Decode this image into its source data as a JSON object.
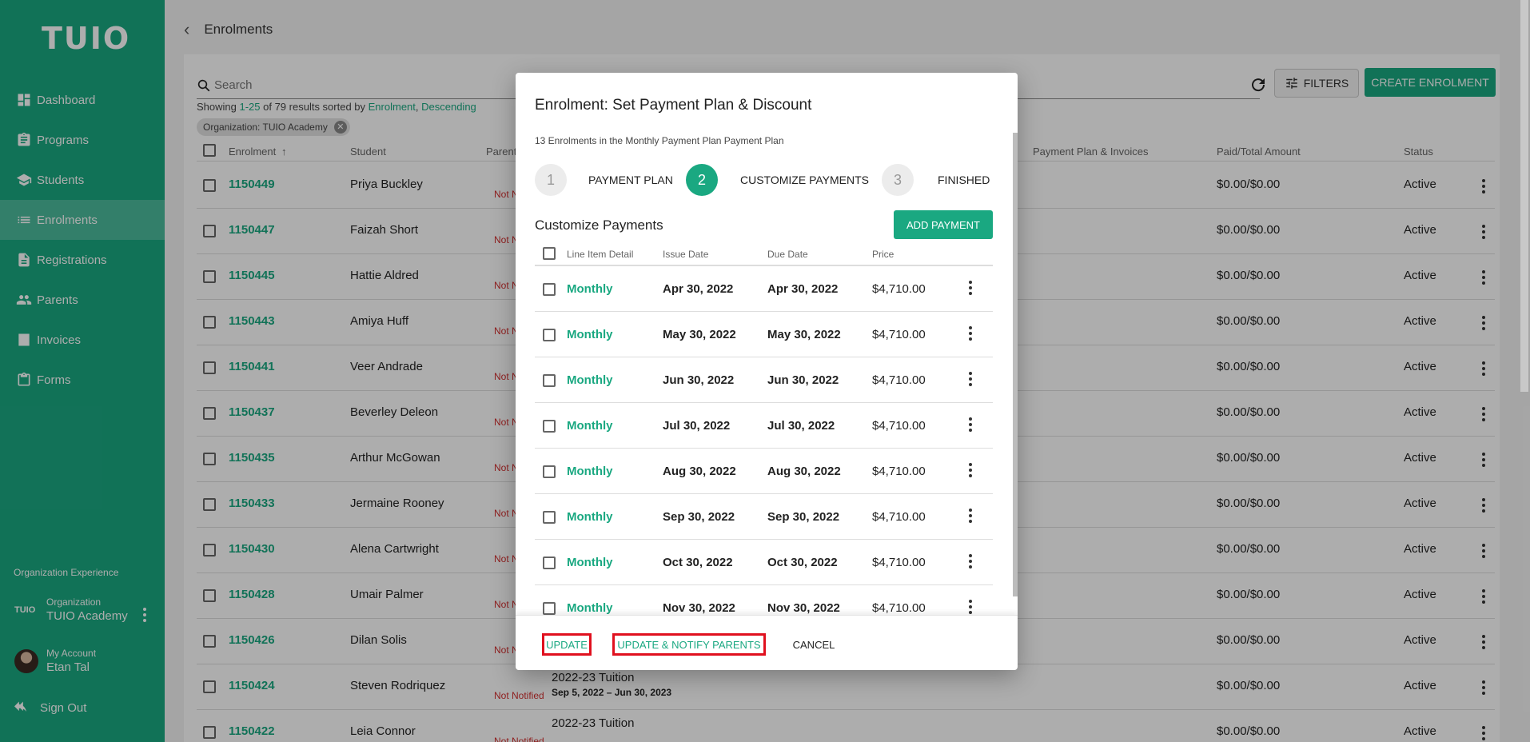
{
  "sidebar": {
    "logo": "TUIO",
    "items": [
      {
        "label": "Dashboard",
        "icon": "dashboard-icon"
      },
      {
        "label": "Programs",
        "icon": "clipboard-icon"
      },
      {
        "label": "Students",
        "icon": "school-icon"
      },
      {
        "label": "Enrolments",
        "icon": "list-icon",
        "active": true
      },
      {
        "label": "Registrations",
        "icon": "document-icon"
      },
      {
        "label": "Parents",
        "icon": "people-icon"
      },
      {
        "label": "Invoices",
        "icon": "receipt-icon"
      },
      {
        "label": "Forms",
        "icon": "form-icon"
      }
    ],
    "org_experience": "Organization Experience",
    "org_logo_small": "TUIO",
    "org_label": "Organization",
    "org_name": "TUIO Academy",
    "account_label": "My Account",
    "account_name": "Etan Tal",
    "sign_out": "Sign Out"
  },
  "page": {
    "title": "Enrolments",
    "search_placeholder": "Search",
    "filters_label": "FILTERS",
    "create_label": "CREATE ENROLMENT",
    "showing_prefix": "Showing ",
    "showing_range": "1-25",
    "showing_mid": " of 79 results sorted by ",
    "sort_field": "Enrolment",
    "sort_sep": ", ",
    "sort_dir": "Descending",
    "chip": "Organization: TUIO Academy",
    "columns": {
      "enrolment": "Enrolment",
      "student": "Student",
      "parent": "Parent",
      "plan": "Payment Plan & Invoices",
      "paid": "Paid/Total Amount",
      "status": "Status"
    },
    "rows": [
      {
        "id": "1150449",
        "student": "Priya Buckley",
        "notified": "Not N",
        "paid": "$0.00/$0.00",
        "status": "Active"
      },
      {
        "id": "1150447",
        "student": "Faizah Short",
        "notified": "Not N",
        "paid": "$0.00/$0.00",
        "status": "Active"
      },
      {
        "id": "1150445",
        "student": "Hattie Aldred",
        "notified": "Not N",
        "paid": "$0.00/$0.00",
        "status": "Active"
      },
      {
        "id": "1150443",
        "student": "Amiya Huff",
        "notified": "Not N",
        "paid": "$0.00/$0.00",
        "status": "Active"
      },
      {
        "id": "1150441",
        "student": "Veer Andrade",
        "notified": "Not N",
        "paid": "$0.00/$0.00",
        "status": "Active"
      },
      {
        "id": "1150437",
        "student": "Beverley Deleon",
        "notified": "Not N",
        "paid": "$0.00/$0.00",
        "status": "Active"
      },
      {
        "id": "1150435",
        "student": "Arthur McGowan",
        "notified": "Not N",
        "paid": "$0.00/$0.00",
        "status": "Active"
      },
      {
        "id": "1150433",
        "student": "Jermaine Rooney",
        "notified": "Not N",
        "paid": "$0.00/$0.00",
        "status": "Active"
      },
      {
        "id": "1150430",
        "student": "Alena Cartwright",
        "notified": "Not N",
        "paid": "$0.00/$0.00",
        "status": "Active"
      },
      {
        "id": "1150428",
        "student": "Umair Palmer",
        "notified": "Not N",
        "paid": "$0.00/$0.00",
        "status": "Active"
      },
      {
        "id": "1150426",
        "student": "Dilan Solis",
        "notified": "Not N",
        "paid": "$0.00/$0.00",
        "status": "Active"
      },
      {
        "id": "1150424",
        "student": "Steven Rodriquez",
        "notified": "Not Notified",
        "program": "2022-23 Tuition",
        "dates": "Sep 5, 2022 – Jun 30, 2023",
        "paid": "$0.00/$0.00",
        "status": "Active"
      },
      {
        "id": "1150422",
        "student": "Leia Connor",
        "notified": "Not Notified",
        "program": "2022-23 Tuition",
        "dates": "",
        "paid": "$0.00/$0.00",
        "status": "Active"
      }
    ]
  },
  "modal": {
    "title": "Enrolment: Set Payment Plan & Discount",
    "subtitle": "13 Enrolments in the Monthly Payment Plan Payment Plan",
    "steps": [
      {
        "num": "1",
        "label": "PAYMENT PLAN"
      },
      {
        "num": "2",
        "label": "CUSTOMIZE PAYMENTS"
      },
      {
        "num": "3",
        "label": "FINISHED"
      }
    ],
    "section_title": "Customize Payments",
    "add_payment": "ADD PAYMENT",
    "columns": {
      "detail": "Line Item Detail",
      "issue": "Issue Date",
      "due": "Due Date",
      "price": "Price"
    },
    "payments": [
      {
        "detail": "Monthly",
        "issue": "Apr 30, 2022",
        "due": "Apr 30, 2022",
        "price": "$4,710.00"
      },
      {
        "detail": "Monthly",
        "issue": "May 30, 2022",
        "due": "May 30, 2022",
        "price": "$4,710.00"
      },
      {
        "detail": "Monthly",
        "issue": "Jun 30, 2022",
        "due": "Jun 30, 2022",
        "price": "$4,710.00"
      },
      {
        "detail": "Monthly",
        "issue": "Jul 30, 2022",
        "due": "Jul 30, 2022",
        "price": "$4,710.00"
      },
      {
        "detail": "Monthly",
        "issue": "Aug 30, 2022",
        "due": "Aug 30, 2022",
        "price": "$4,710.00"
      },
      {
        "detail": "Monthly",
        "issue": "Sep 30, 2022",
        "due": "Sep 30, 2022",
        "price": "$4,710.00"
      },
      {
        "detail": "Monthly",
        "issue": "Oct 30, 2022",
        "due": "Oct 30, 2022",
        "price": "$4,710.00"
      },
      {
        "detail": "Monthly",
        "issue": "Nov 30, 2022",
        "due": "Nov 30, 2022",
        "price": "$4,710.00"
      }
    ],
    "update": "UPDATE",
    "update_notify": "UPDATE & NOTIFY PARENTS",
    "cancel": "CANCEL"
  },
  "colors": {
    "brand": "#1aa881",
    "alert": "#d32f2f",
    "highlight": "#e0101e"
  }
}
